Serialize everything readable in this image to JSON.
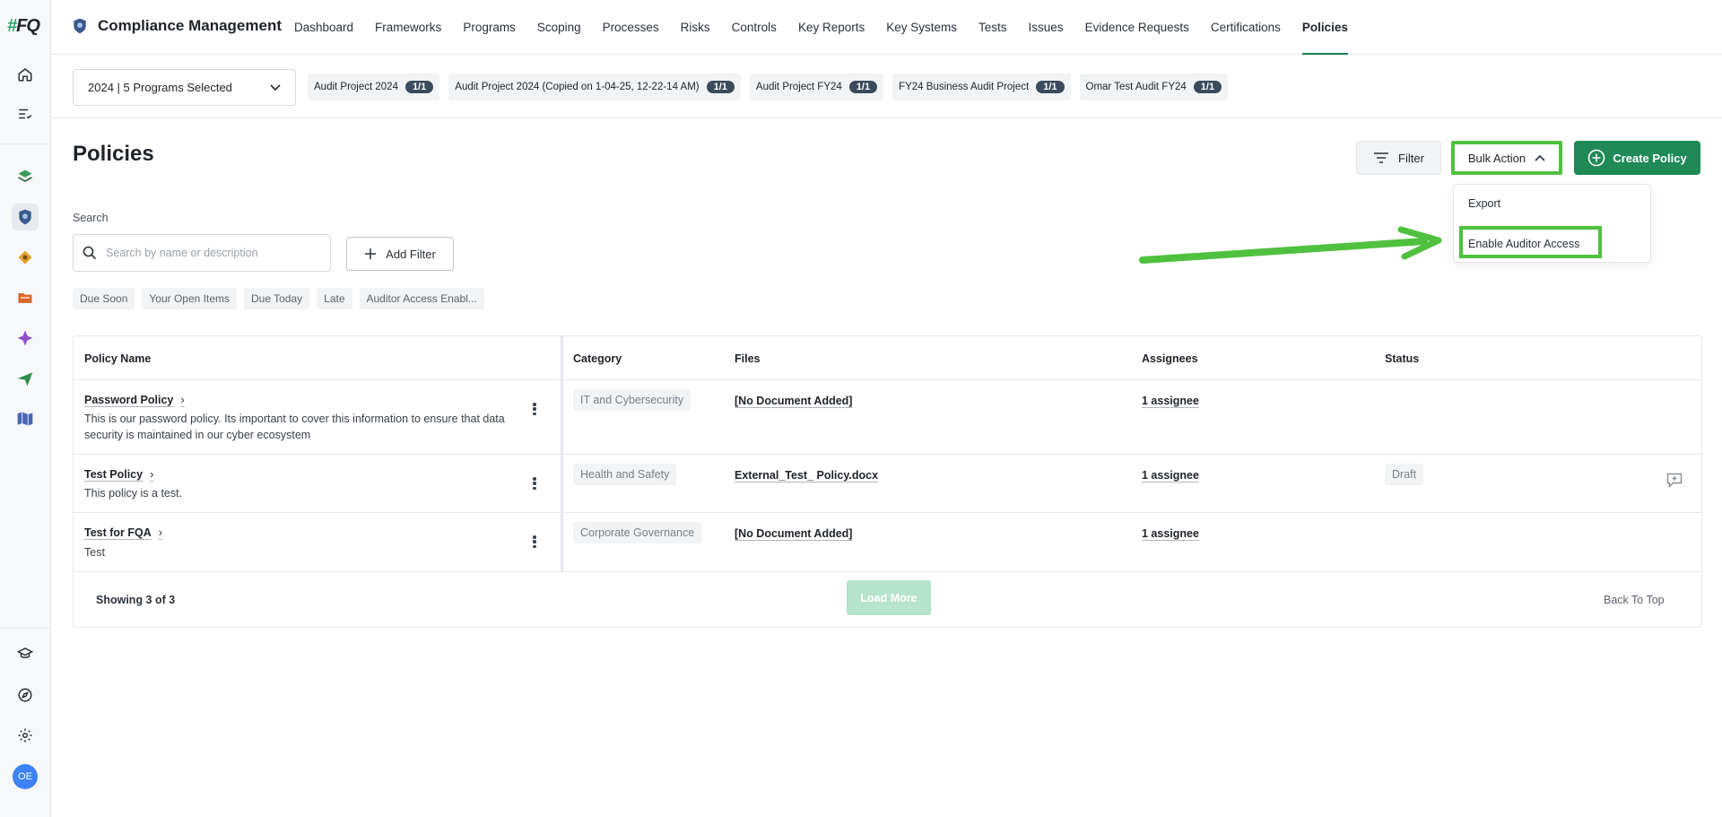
{
  "app": {
    "logo": "#FQ",
    "title": "Compliance Management",
    "user_initials": "OE"
  },
  "nav": {
    "items": [
      "Dashboard",
      "Frameworks",
      "Programs",
      "Scoping",
      "Processes",
      "Risks",
      "Controls",
      "Key Reports",
      "Key Systems",
      "Tests",
      "Issues",
      "Evidence Requests",
      "Certifications",
      "Policies"
    ],
    "active": "Policies"
  },
  "program_bar": {
    "selector": "2024 | 5 Programs Selected",
    "chips": [
      {
        "label": "Audit Project 2024",
        "count": "1/1"
      },
      {
        "label": "Audit Project 2024 (Copied on 1-04-25, 12-22-14 AM)",
        "count": "1/1"
      },
      {
        "label": "Audit Project FY24",
        "count": "1/1"
      },
      {
        "label": "FY24 Business Audit Project",
        "count": "1/1"
      },
      {
        "label": "Omar Test Audit FY24",
        "count": "1/1"
      }
    ]
  },
  "page": {
    "title": "Policies",
    "filter_label": "Filter",
    "bulk_action_label": "Bulk Action",
    "create_label": "Create Policy",
    "bulk_menu": {
      "export": "Export",
      "enable_auditor": "Enable Auditor Access"
    },
    "search_label": "Search",
    "search_placeholder": "Search by name or description",
    "add_filter_label": "Add Filter",
    "quick_filters": [
      "Due Soon",
      "Your Open Items",
      "Due Today",
      "Late",
      "Auditor Access Enabl..."
    ]
  },
  "table": {
    "headers": {
      "name": "Policy Name",
      "category": "Category",
      "files": "Files",
      "assignees": "Assignees",
      "status": "Status"
    },
    "rows": [
      {
        "name": "Password Policy",
        "desc": "This is our password policy. Its important to cover this information to ensure that data security is maintained in our cyber ecosystem",
        "category": "IT and Cybersecurity",
        "file": "[No Document Added]",
        "assignee": "1 assignee",
        "status": ""
      },
      {
        "name": "Test Policy",
        "desc": "This policy is a test.",
        "category": "Health and Safety",
        "file": "External_Test_ Policy.docx",
        "assignee": "1 assignee",
        "status": "Draft"
      },
      {
        "name": "Test for FQA",
        "desc": "Test",
        "category": "Corporate Governance",
        "file": "[No Document Added]",
        "assignee": "1 assignee",
        "status": ""
      }
    ],
    "showing": "Showing 3 of 3",
    "load_more": "Load More",
    "back_to_top": "Back To Top"
  },
  "colors": {
    "accent": "#1f8a56",
    "highlight": "#4fc13f",
    "chip_count_bg": "#3b4a5c"
  }
}
